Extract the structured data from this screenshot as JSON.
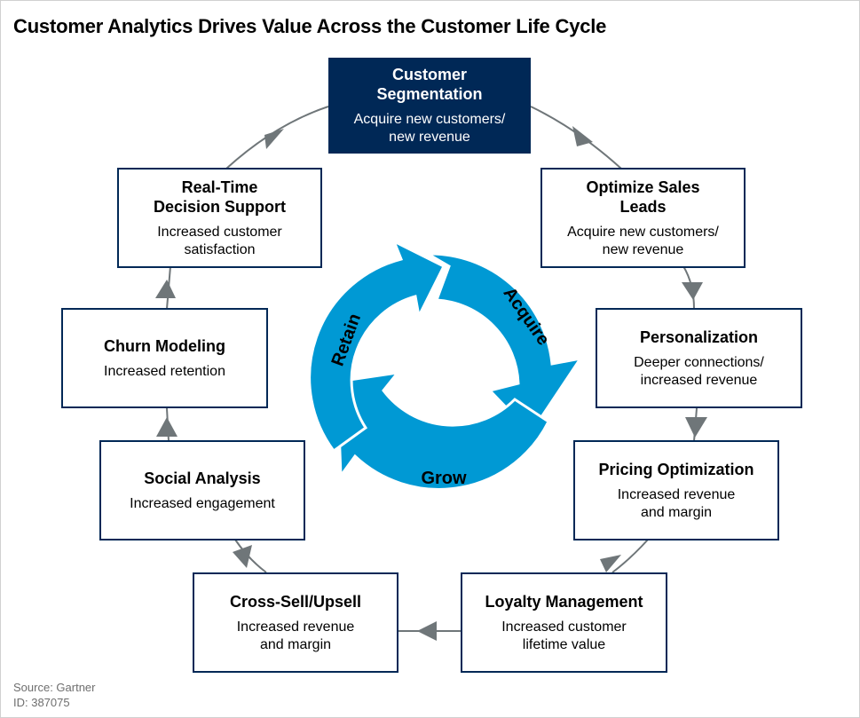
{
  "title": "Customer Analytics Drives Value Across the Customer Life Cycle",
  "colors": {
    "dark_box": "#002856",
    "cycle": "#0099d4",
    "connector": "#6f7679"
  },
  "cycle": {
    "labels": [
      "Acquire",
      "Grow",
      "Retain"
    ]
  },
  "boxes": [
    {
      "heading": "Customer Segmentation",
      "heading_lines": [
        "Customer",
        "Segmentation"
      ],
      "sub": [
        "Acquire new customers/",
        "new revenue"
      ]
    },
    {
      "heading": "Optimize Sales Leads",
      "heading_lines": [
        "Optimize Sales",
        "Leads"
      ],
      "sub": [
        "Acquire new customers/",
        "new revenue"
      ]
    },
    {
      "heading": "Personalization",
      "heading_lines": [
        "Personalization"
      ],
      "sub": [
        "Deeper connections/",
        "increased revenue"
      ]
    },
    {
      "heading": "Pricing Optimization",
      "heading_lines": [
        "Pricing Optimization"
      ],
      "sub": [
        "Increased revenue",
        "and margin"
      ]
    },
    {
      "heading": "Loyalty Management",
      "heading_lines": [
        "Loyalty Management"
      ],
      "sub": [
        "Increased customer",
        "lifetime value"
      ]
    },
    {
      "heading": "Cross-Sell/Upsell",
      "heading_lines": [
        "Cross-Sell/Upsell"
      ],
      "sub": [
        "Increased revenue",
        "and margin"
      ]
    },
    {
      "heading": "Social Analysis",
      "heading_lines": [
        "Social Analysis"
      ],
      "sub": [
        "Increased engagement"
      ]
    },
    {
      "heading": "Churn Modeling",
      "heading_lines": [
        "Churn Modeling"
      ],
      "sub": [
        "Increased retention"
      ]
    },
    {
      "heading": "Real-Time Decision Support",
      "heading_lines": [
        "Real-Time",
        "Decision Support"
      ],
      "sub": [
        "Increased customer",
        "satisfaction"
      ]
    }
  ],
  "source": {
    "line1": "Source: Gartner",
    "line2": "ID: 387075"
  }
}
